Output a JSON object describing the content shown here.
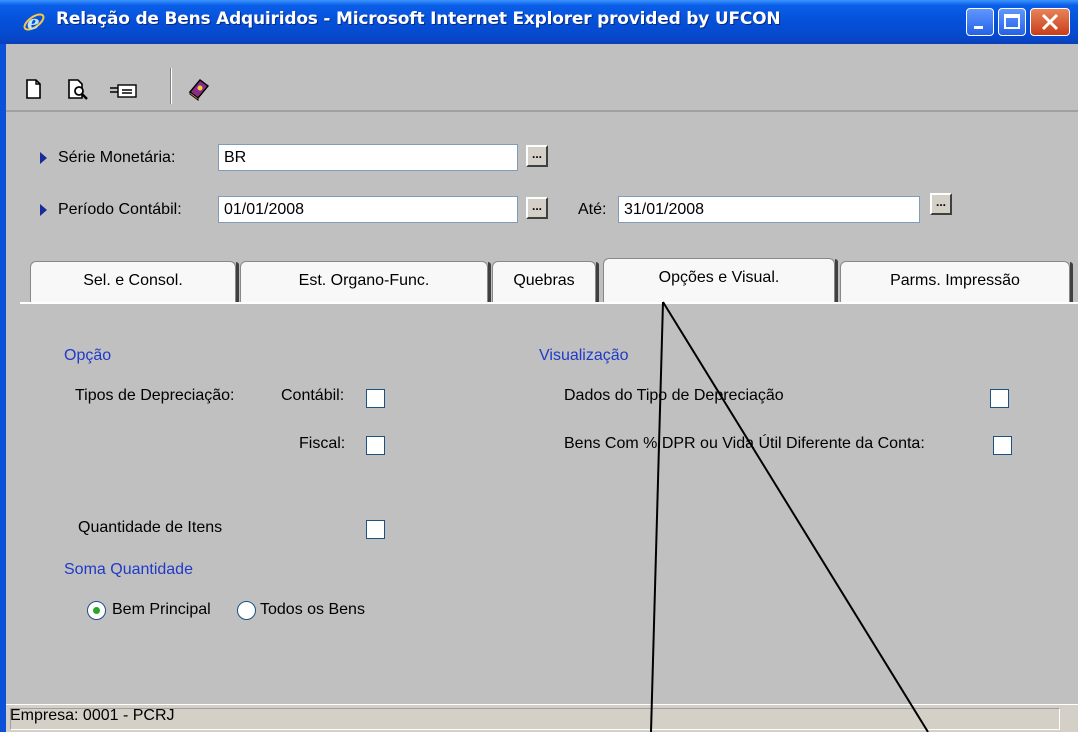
{
  "window": {
    "title": "Relação de Bens Adquiridos - Microsoft Internet Explorer provided by UFCON"
  },
  "toolbar": {
    "icons": [
      "new-document-icon",
      "print-preview-icon",
      "export-icon",
      "help-book-icon"
    ]
  },
  "filters": {
    "serie_label": "Série Monetária:",
    "serie_value": "BR",
    "periodo_label": "Período Contábil:",
    "periodo_from": "01/01/2008",
    "ate_label": "Até:",
    "periodo_to": "31/01/2008",
    "ellipsis": "..."
  },
  "tabs": [
    {
      "label": "Sel. e Consol.",
      "active": false
    },
    {
      "label": "Est. Organo-Func.",
      "active": false
    },
    {
      "label": "Quebras",
      "active": false
    },
    {
      "label": "Opções e Visual.",
      "active": true
    },
    {
      "label": "Parms. Impressão",
      "active": false
    }
  ],
  "opcao": {
    "heading": "Opção",
    "tipos_label": "Tipos de Depreciação:",
    "contabil_label": "Contábil:",
    "contabil_checked": false,
    "fiscal_label": "Fiscal:",
    "fiscal_checked": false,
    "quantidade_label": "Quantidade de Itens",
    "quantidade_checked": false
  },
  "soma": {
    "heading": "Soma Quantidade",
    "bem_principal_label": "Bem Principal",
    "todos_label": "Todos os Bens",
    "selected": "Bem Principal"
  },
  "visualizacao": {
    "heading": "Visualização",
    "dados_label": "Dados do Tipo de Depreciação",
    "dados_checked": false,
    "bens_label": "Bens Com % DPR ou Vida Útil Diferente da Conta:",
    "bens_checked": false
  },
  "status": {
    "empresa": "Empresa: 0001 - PCRJ"
  },
  "colors": {
    "titlebar": "#0550d8",
    "panel": "#c0c0c0",
    "section_heading": "#1f3ac8",
    "radio_selected": "#2aa52a"
  }
}
